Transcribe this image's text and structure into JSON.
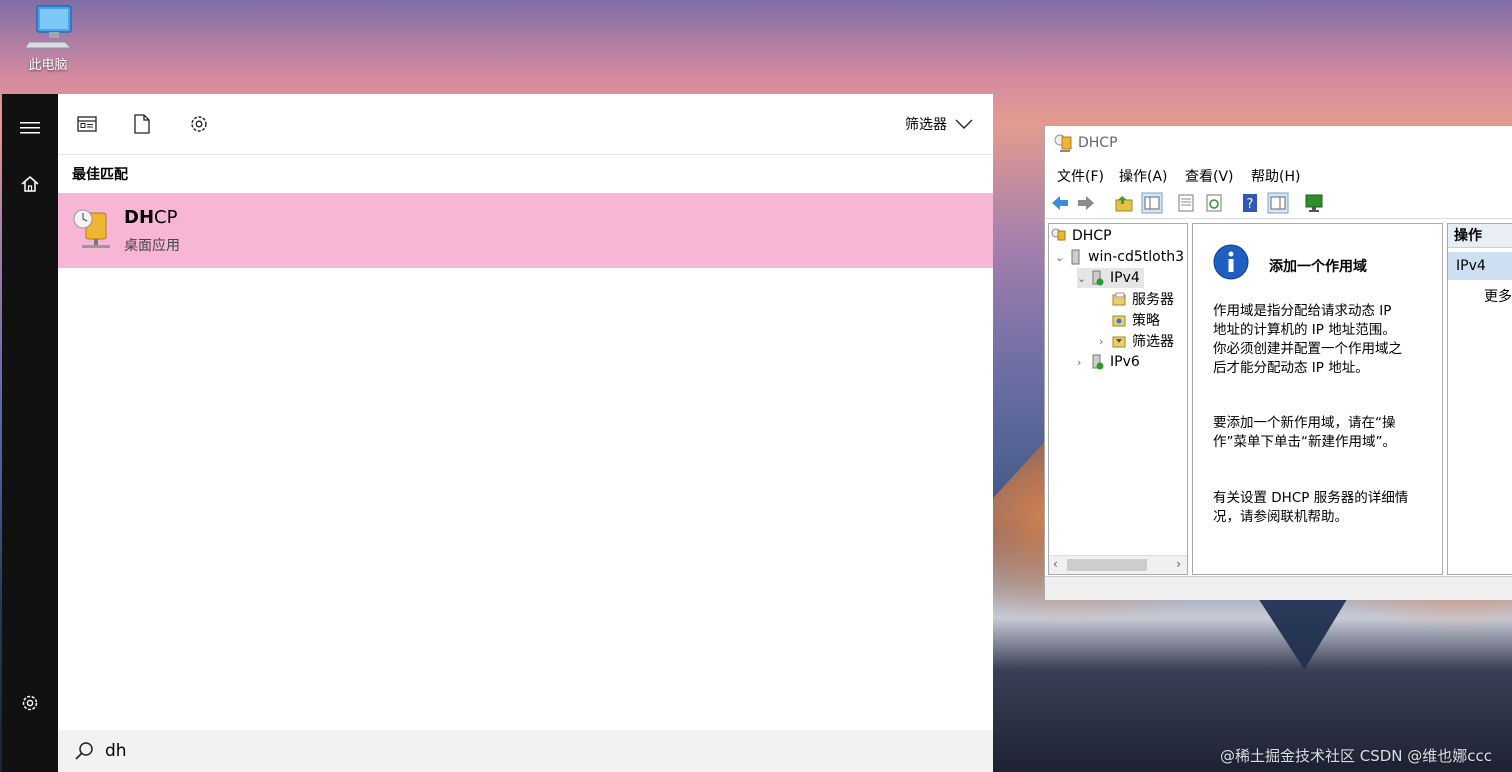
{
  "desktop": {
    "this_pc_label": "此电脑"
  },
  "start_menu": {
    "filter_label": "筛选器",
    "best_match_heading": "最佳匹配",
    "best_match": {
      "name_bold": "DH",
      "name_rest": "CP",
      "subtitle": "桌面应用"
    },
    "search_value": "dh"
  },
  "dhcp_window": {
    "title": "DHCP",
    "menu": [
      "文件(F)",
      "操作(A)",
      "查看(V)",
      "帮助(H)"
    ],
    "tree": {
      "root": "DHCP",
      "server": "win-cd5tloth3",
      "ipv4": "IPv4",
      "ipv4_children": [
        "服务器",
        "策略",
        "筛选器"
      ],
      "ipv6": "IPv6"
    },
    "info": {
      "heading": "添加一个作用域",
      "p1": "作用域是指分配给请求动态 IP 地址的计算机的 IP 地址范围。你必须创建并配置一个作用域之后才能分配动态 IP 地址。",
      "p2": "要添加一个新作用域，请在“操作”菜单下单击“新建作用域”。",
      "p3": "有关设置 DHCP 服务器的详细情况，请参阅联机帮助。"
    },
    "actions": {
      "header": "操作",
      "selected": "IPv4",
      "more": "更多"
    }
  },
  "watermark": "@稀土掘金技术社区  CSDN @维也娜ccc",
  "colors": {
    "best_match_bg": "#f8b6d6",
    "rail_bg": "#111111"
  }
}
